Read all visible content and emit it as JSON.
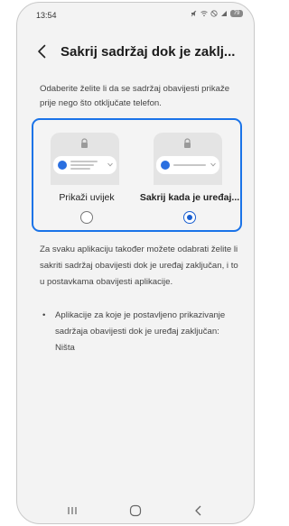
{
  "status_bar": {
    "time": "13:54",
    "battery": "79"
  },
  "header": {
    "title": "Sakrij sadržaj dok je zaklj..."
  },
  "intro": "Odaberite želite li da se sadržaj obavijesti prikaže prije nego što otključate telefon.",
  "options": [
    {
      "label": "Prikaži uvijek",
      "selected": false
    },
    {
      "label": "Sakrij kada je uređaj...",
      "selected": true
    }
  ],
  "info_text": "Za svaku aplikaciju također možete odabrati želite li sakriti sadržaj obavijesti dok je uređaj zaključan, i to u postavkama obavijesti aplikacije.",
  "bullet": {
    "marker": "•",
    "text": "Aplikacije za koje je postavljeno prikazivanje sadržaja obavijesti dok je uređaj zaključan: Ništa"
  },
  "colors": {
    "accent": "#1a73e8",
    "radio_selected": "#1a5fd0",
    "background": "#f3f3f3"
  },
  "icons": [
    "back-arrow-icon",
    "lock-icon",
    "recent-apps-icon",
    "home-icon",
    "back-icon"
  ]
}
